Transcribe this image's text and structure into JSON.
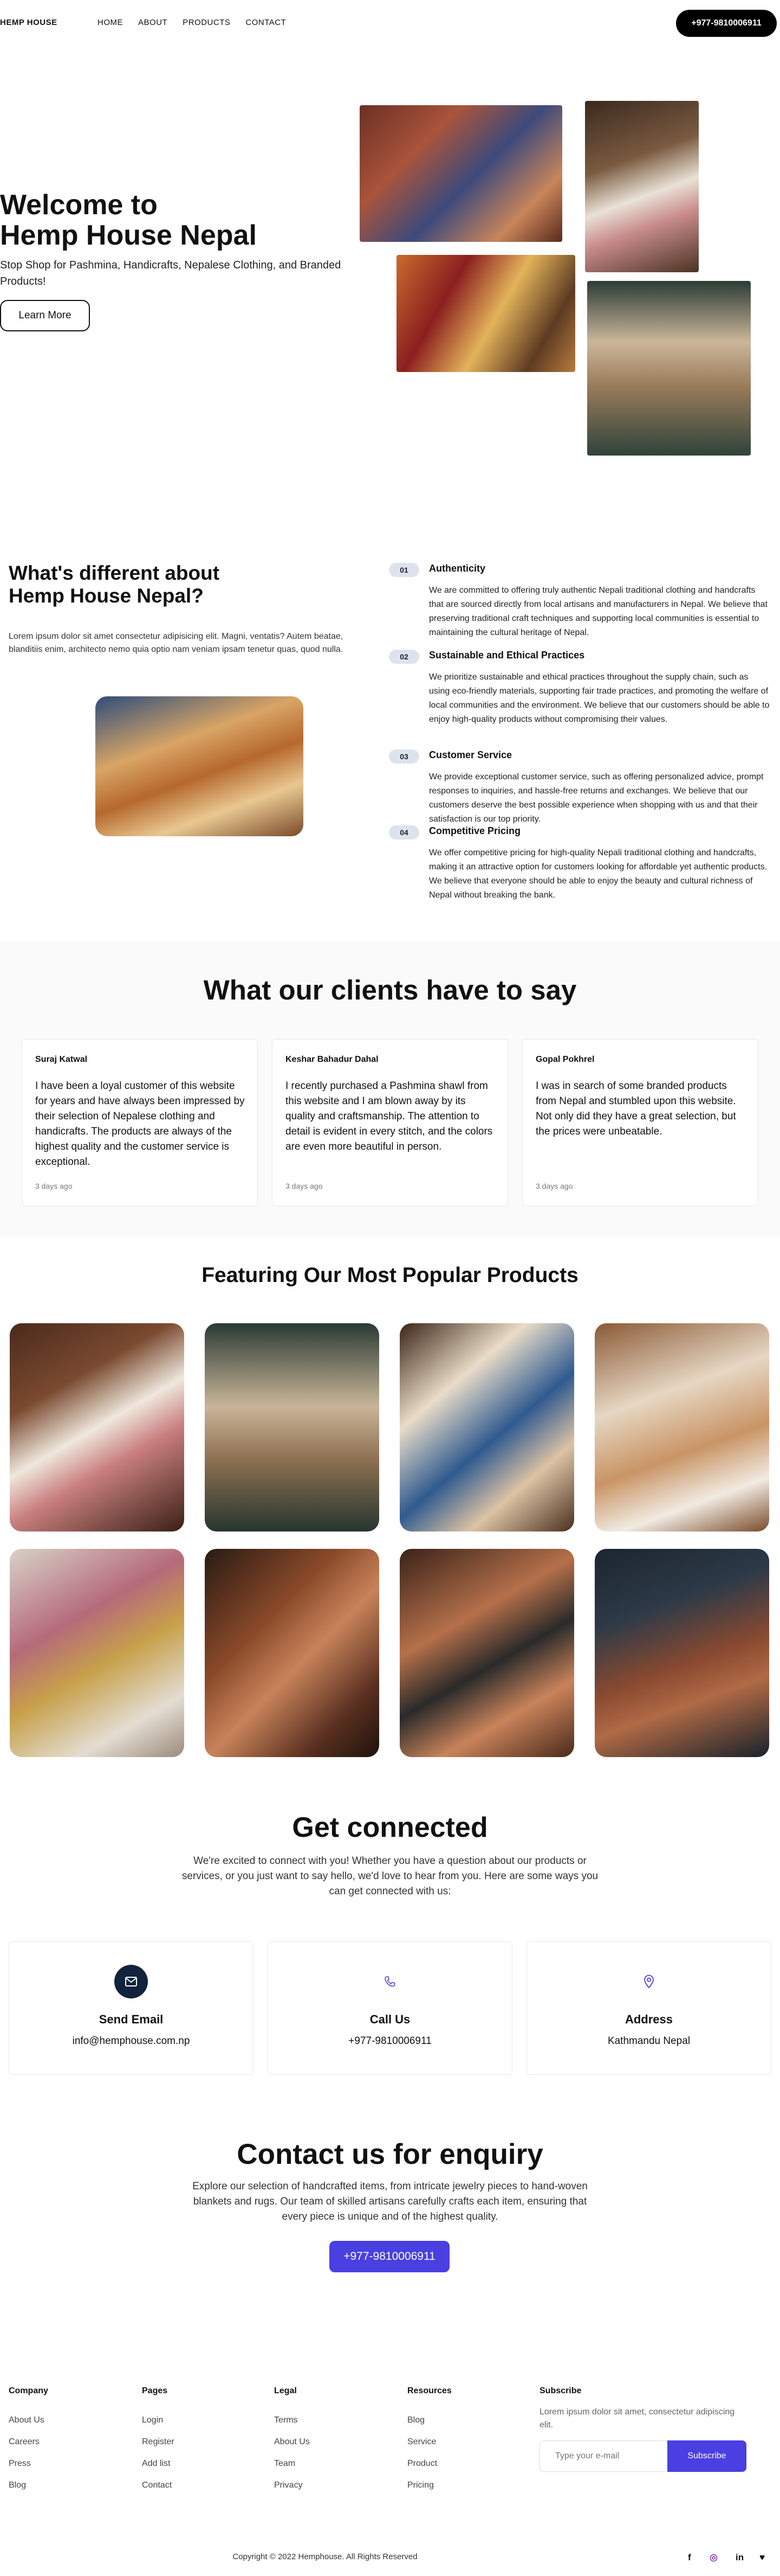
{
  "nav": {
    "logo": "HEMP HOUSE",
    "links": [
      "HOME",
      "ABOUT",
      "PRODUCTS",
      "CONTACT"
    ],
    "phone": "+977-9810006911"
  },
  "hero": {
    "title_line1": "Welcome to",
    "title_line2": "Hemp House Nepal",
    "subtitle": "Stop Shop for Pashmina, Handicrafts, Nepalese Clothing, and Branded Products!",
    "button": "Learn More"
  },
  "different": {
    "title": "What's different about Hemp House Nepal?",
    "text": "Lorem ipsum dolor sit amet consectetur adipisicing elit. Magni, ventatis? Autem beatae, blanditiis enim, architecto nemo quia optio nam veniam ipsam tenetur quas, quod nulla.",
    "features": [
      {
        "num": "01",
        "title": "Authenticity",
        "desc": "We are committed to offering truly authentic Nepali traditional clothing and handcrafts that are sourced directly from local artisans and manufacturers in Nepal. We believe that preserving traditional craft techniques and supporting local communities is essential to maintaining the cultural heritage of Nepal."
      },
      {
        "num": "02",
        "title": "Sustainable and Ethical Practices",
        "desc": "We prioritize sustainable and ethical practices throughout the supply chain, such as using eco-friendly materials, supporting fair trade practices, and promoting the welfare of local communities and the environment. We believe that our customers should be able to enjoy high-quality products without compromising their values."
      },
      {
        "num": "03",
        "title": "Customer Service",
        "desc": "We provide exceptional customer service, such as offering personalized advice, prompt responses to inquiries, and hassle-free returns and exchanges. We believe that our customers deserve the best possible experience when shopping with us and that their satisfaction is our top priority."
      },
      {
        "num": "04",
        "title": "Competitive Pricing",
        "desc": "We offer competitive pricing for high-quality Nepali traditional clothing and handcrafts, making it an attractive option for customers looking for affordable yet authentic products. We believe that everyone should be able to enjoy the beauty and cultural richness of Nepal without breaking the bank."
      }
    ]
  },
  "testimonials": {
    "title": "What our clients have to say",
    "items": [
      {
        "name": "Suraj Katwal",
        "text": "I have been a loyal customer of this website for years and have always been impressed by their selection of Nepalese clothing and handicrafts. The products are always of the highest quality and the customer service is exceptional.",
        "time": "3 days ago"
      },
      {
        "name": "Keshar Bahadur Dahal",
        "text": "I recently purchased a Pashmina shawl from this website and I am blown away by its quality and craftsmanship. The attention to detail is evident in every stitch, and the colors are even more beautiful in person.",
        "time": "3 days ago"
      },
      {
        "name": "Gopal Pokhrel",
        "text": "I was in search of some branded products from Nepal and stumbled upon this website. Not only did they have a great selection, but the prices were unbeatable.",
        "time": "3 days ago"
      }
    ]
  },
  "products": {
    "title": "Featuring Our Most Popular Products"
  },
  "connect": {
    "title": "Get connected",
    "text": "We're excited to connect with you! Whether you have a question about our products or services, or you just want to say hello, we'd love to hear from you. Here are some ways you can get connected with us:",
    "cards": [
      {
        "title": "Send Email",
        "value": "info@hemphouse.com.np",
        "icon": "mail-icon"
      },
      {
        "title": "Call Us",
        "value": "+977-9810006911",
        "icon": "phone-icon"
      },
      {
        "title": "Address",
        "value": "Kathmandu Nepal",
        "icon": "location-pin-icon"
      }
    ]
  },
  "enquiry": {
    "title": "Contact us for enquiry",
    "text": "Explore our selection of handcrafted items, from intricate jewelry pieces to hand-woven blankets and rugs. Our team of skilled artisans carefully crafts each item, ensuring that every piece is unique and of the highest quality.",
    "button": "+977-9810006911"
  },
  "footer": {
    "columns": [
      {
        "heading": "Company",
        "items": [
          "About Us",
          "Careers",
          "Press",
          "Blog"
        ]
      },
      {
        "heading": "Pages",
        "items": [
          "Login",
          "Register",
          "Add list",
          "Contact"
        ]
      },
      {
        "heading": "Legal",
        "items": [
          "Terms",
          "About Us",
          "Team",
          "Privacy"
        ]
      },
      {
        "heading": "Resources",
        "items": [
          "Blog",
          "Service",
          "Product",
          "Pricing"
        ]
      }
    ],
    "subscribe": {
      "heading": "Subscribe",
      "text": "Lorem ipsum dolor sit amet, consectetur adipiscing elit.",
      "placeholder": "Type your e-mail",
      "button": "Subscribe"
    },
    "copyright": "Copyright © 2022 Hemphouse. All Rights Reserved",
    "social": [
      "f",
      "◎",
      "in",
      "♥"
    ]
  },
  "colors": {
    "accent": "#4a3fe0",
    "dark_circle": "#12233d"
  }
}
